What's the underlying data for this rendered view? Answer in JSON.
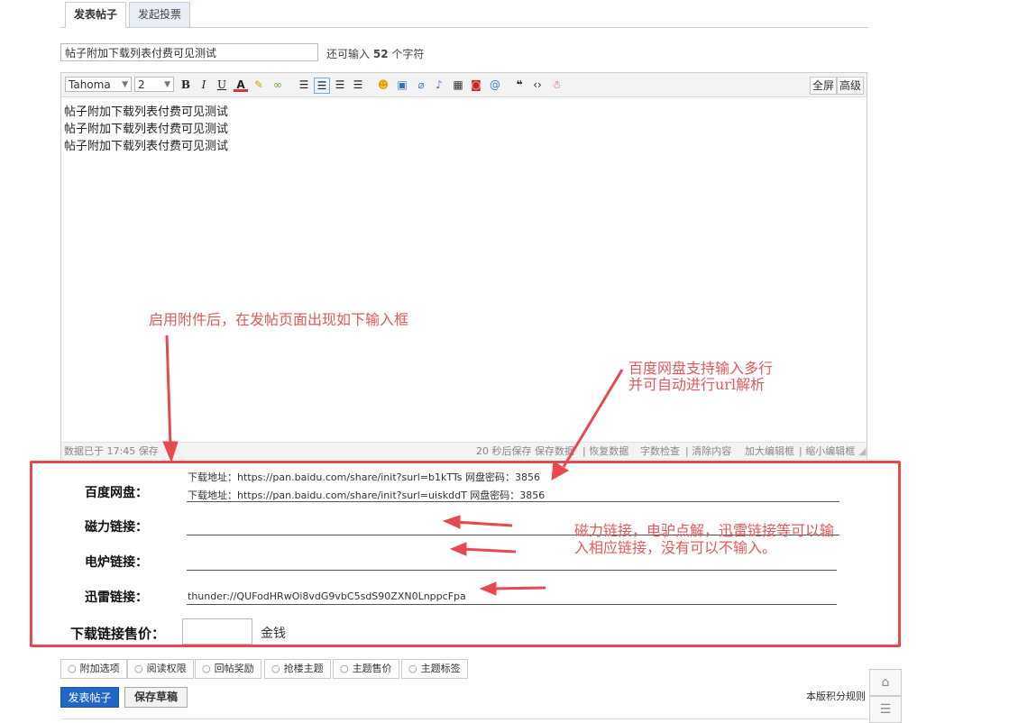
{
  "tabs": [
    "发表帖子",
    "发起投票"
  ],
  "title_input": {
    "value": "帖子附加下载列表付费可见测试"
  },
  "remain": {
    "prefix": "还可输入",
    "count": "52",
    "suffix": "个字符"
  },
  "toolbar": {
    "font": "Tahoma",
    "size": "2",
    "fullscreen": "全屏",
    "advanced": "高级"
  },
  "editor": {
    "lines": [
      "帖子附加下载列表付费可见测试",
      "帖子附加下载列表付费可见测试",
      "帖子附加下载列表付费可见测试"
    ]
  },
  "statusbar": {
    "left": "数据已于 17:45 保存",
    "autosave": "20 秒后保存 保存数据",
    "restore": "恢复数据",
    "check": "字数检查",
    "clear": "清除内容",
    "enlarge": "加大编辑框",
    "shrink": "缩小编辑框"
  },
  "attach": {
    "baidu_label": "百度网盘：",
    "baidu_lines": [
      "下载地址：https://pan.baidu.com/share/init?surl=b1kTTs  网盘密码：3856",
      "下载地址：https://pan.baidu.com/share/init?surl=uiskddT  网盘密码：3856"
    ],
    "magnet_label": "磁力链接：",
    "ed2k_label": "电炉链接：",
    "thunder_label": "迅雷链接：",
    "thunder_value": "thunder://QUFodHRwOi8vdG9vbC5sdS90ZXN0LnppcFpa",
    "price_label": "下载链接售价：",
    "price_unit": "金钱"
  },
  "annotations": {
    "a1": "启用附件后，在发帖页面出现如下输入框",
    "a2_line1": "百度网盘支持输入多行",
    "a2_line2": "并可自动进行url解析",
    "a3_line1": "磁力链接，电驴点解，迅雷链接等可以输",
    "a3_line2": "入相应链接，没有可以不输入。"
  },
  "options": [
    "附加选项",
    "阅读权限",
    "回帖奖励",
    "抢楼主题",
    "主题售价",
    "主题标签"
  ],
  "buttons": {
    "post": "发表帖子",
    "draft": "保存草稿"
  },
  "rules": "本版积分规则",
  "colors": {
    "accent_red": "#e8494e",
    "annotation_red": "#e05a5a",
    "primary_blue": "#2367c6"
  },
  "icons": [
    "bold-icon",
    "italic-icon",
    "underline-icon",
    "font-color-icon",
    "highlight-icon",
    "link-icon",
    "align-left-icon",
    "align-center-icon",
    "align-right-icon",
    "smiley-icon",
    "image-icon",
    "attachment-icon",
    "music-icon",
    "video-icon",
    "flash-icon",
    "at-icon",
    "quote-icon",
    "code-icon",
    "qq-icon"
  ]
}
